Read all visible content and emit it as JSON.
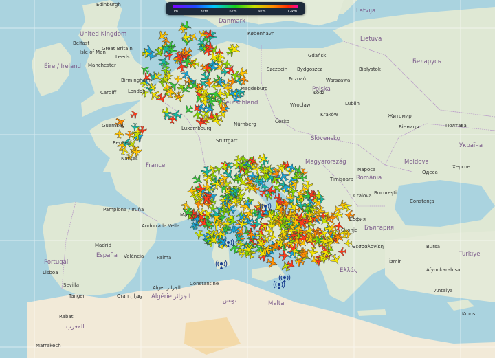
{
  "legend": {
    "ticks": [
      "0m",
      "3km",
      "6km",
      "9km",
      "12km"
    ]
  },
  "labels": {
    "countries": {
      "uk": "United Kingdom",
      "ireland": "Éire / Ireland",
      "great_britain": "Great Britain",
      "isle_of_man": "Isle of Man",
      "denmark": "Danmark",
      "deutschland": "Deutschland",
      "polska": "Polska",
      "france": "France",
      "espana": "España",
      "portugal": "Portugal",
      "magyarorszag": "Magyarország",
      "romania": "România",
      "slovensko": "Slovensko",
      "moldova": "Moldova",
      "ukraina": "Україна",
      "belarus": "Беларусь",
      "lietuva": "Lietuva",
      "latvija": "Latvija",
      "bulgaria": "България",
      "turkiye": "Türkiye",
      "ellas": "Ελλάς",
      "malta": "Malta",
      "algerie": "Algérie الجزائر",
      "tunisie": "تونس",
      "maroc": "المغرب"
    },
    "cities": {
      "edinburgh": "Edinburgh",
      "belfast": "Belfast",
      "leeds": "Leeds",
      "manchester": "Manchester",
      "birmingham": "Birmingham",
      "cardiff": "Cardiff",
      "london": "London",
      "guernsey": "Guernsey",
      "rennes": "Rennes",
      "nantes": "Nantes",
      "luxembourg": "Luxembourg",
      "kobenhavn": "København",
      "magdeburg": "Magdeburg",
      "nurnberg": "Nürnberg",
      "stuttgart": "Stuttgart",
      "szczecin": "Szczecin",
      "gdansk": "Gdańsk",
      "bydgoszcz": "Bydgoszcz",
      "poznan": "Poznań",
      "warszawa": "Warszawa",
      "wroclaw": "Wrocław",
      "krakow": "Kraków",
      "lodz": "Łódź",
      "lublin": "Lublin",
      "bialystok": "Białystok",
      "ceske": "Česko",
      "zitomir": "Житомир",
      "vinnicja": "Вінниця",
      "poltava": "Полтава",
      "odesa": "Одеса",
      "herson": "Херсон",
      "napoca": "Napoca",
      "timisoara": "Timișoara",
      "craiova": "Craiova",
      "bucuresti": "București",
      "constanta": "Constanța",
      "sofia": "София",
      "skopje": "Скопје",
      "thessaloniki": "Θεσσαλονίκη",
      "pamplona": "Pamplona / Iruña",
      "andorra": "Andorra la Vella",
      "madrid": "Madrid",
      "valencia": "València",
      "lisboa": "Lisboa",
      "sevilla": "Sevilla",
      "tanger": "Tanger",
      "oran": "Oran وهران",
      "alger": "Alger الجزائر",
      "constantine": "Constantine",
      "marseille": "Marseille",
      "palma": "Palma",
      "rabat": "Rabat",
      "marrakech": "Marrakech",
      "izmir": "İzmir",
      "afyon": "Afyonkarahisar",
      "antalya": "Antalya",
      "bursa": "Bursa",
      "kibris": "Kıbrıs"
    }
  },
  "aircraft_color_scale": [
    "#ff3a1a",
    "#ff8c00",
    "#ffc400",
    "#f2e200",
    "#c8e000",
    "#88d600",
    "#36c83a",
    "#18b8a0",
    "#1aa6d8"
  ],
  "receiver_icon": "antenna-icon",
  "aircraft_icon": "airplane-icon"
}
